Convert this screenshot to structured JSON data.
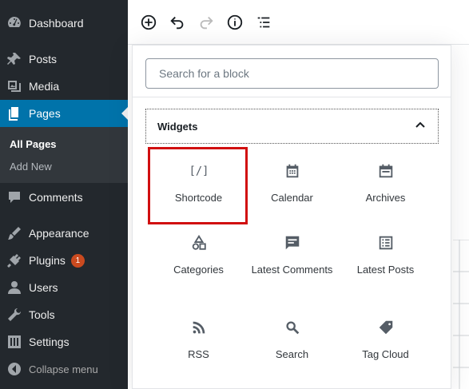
{
  "sidebar": {
    "items": [
      {
        "label": "Dashboard",
        "icon": "dashboard-icon"
      },
      {
        "label": "Posts",
        "icon": "pin-icon"
      },
      {
        "label": "Media",
        "icon": "media-icon"
      },
      {
        "label": "Pages",
        "icon": "pages-icon"
      },
      {
        "label": "Comments",
        "icon": "comments-icon"
      },
      {
        "label": "Appearance",
        "icon": "brush-icon"
      },
      {
        "label": "Plugins",
        "icon": "plug-icon",
        "badge": "1"
      },
      {
        "label": "Users",
        "icon": "user-icon"
      },
      {
        "label": "Tools",
        "icon": "wrench-icon"
      },
      {
        "label": "Settings",
        "icon": "settings-icon"
      }
    ],
    "submenu": [
      "All Pages",
      "Add New"
    ],
    "collapse_label": "Collapse menu"
  },
  "toolbar": {
    "buttons": [
      "add-block-icon",
      "undo-icon",
      "redo-icon",
      "info-icon",
      "outline-icon"
    ]
  },
  "inserter": {
    "search_placeholder": "Search for a block",
    "panel_title": "Widgets",
    "blocks": [
      {
        "label": "Shortcode",
        "icon": "shortcode-icon"
      },
      {
        "label": "Calendar",
        "icon": "calendar-icon"
      },
      {
        "label": "Archives",
        "icon": "archives-icon"
      },
      {
        "label": "Categories",
        "icon": "categories-icon"
      },
      {
        "label": "Latest Comments",
        "icon": "latest-comments-icon"
      },
      {
        "label": "Latest Posts",
        "icon": "latest-posts-icon"
      },
      {
        "label": "RSS",
        "icon": "rss-icon"
      },
      {
        "label": "Search",
        "icon": "search-icon"
      },
      {
        "label": "Tag Cloud",
        "icon": "tag-icon"
      }
    ]
  },
  "colors": {
    "sidebar_bg": "#23282d",
    "current_menu": "#0073aa",
    "highlight": "#d10f10",
    "badge": "#ca4a1f"
  }
}
